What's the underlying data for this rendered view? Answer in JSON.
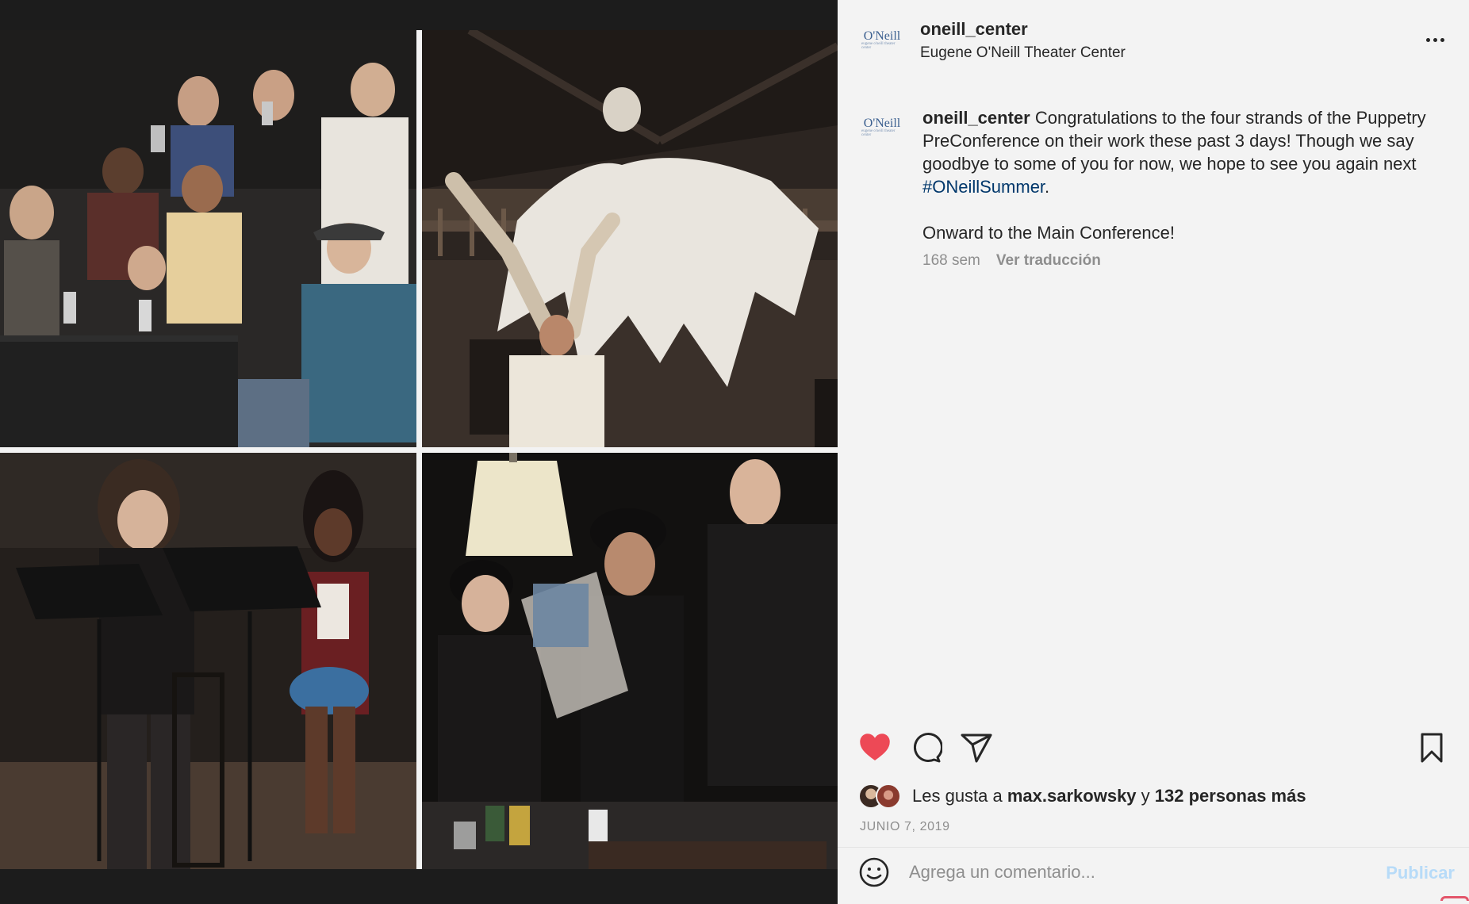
{
  "post": {
    "photos": [
      {
        "name": "photo-puppeteers-table"
      },
      {
        "name": "photo-giant-puppet"
      },
      {
        "name": "photo-reading-stands"
      },
      {
        "name": "photo-performers-jar"
      }
    ]
  },
  "header": {
    "logo_main": "O'Neill",
    "logo_sub": "eugene o'neill theater center",
    "username": "oneill_center",
    "subtitle": "Eugene O'Neill Theater Center"
  },
  "caption": {
    "username": "oneill_center",
    "text_before_tag": " Congratulations to the four strands of the Puppetry PreConference on their work these past 3 days! Though we say goodbye to some of you for now, we hope to see you again next ",
    "hashtag": "#ONeillSummer",
    "text_after_tag": ".",
    "second_paragraph": "Onward to the Main Conference!",
    "time_ago": "168 sem",
    "translate_label": "Ver traducción"
  },
  "actions": {
    "like_icon": "heart-icon",
    "comment_icon": "comment-icon",
    "share_icon": "paper-plane-icon",
    "save_icon": "bookmark-icon",
    "liked": true
  },
  "likes": {
    "prefix": "Les gusta a",
    "user": "max.sarkowsky",
    "connector": "y",
    "count_text": "132 personas más"
  },
  "date": "JUNIO 7, 2019",
  "comment": {
    "placeholder": "Agrega un comentario...",
    "publish_label": "Publicar",
    "emoji_icon": "smiley-icon"
  },
  "colors": {
    "like_red": "#ed4956",
    "hashtag_blue": "#00376b",
    "publish_disabled": "#b7dbf8",
    "muted_text": "#8e8e8e",
    "background": "#f3f3f3"
  }
}
